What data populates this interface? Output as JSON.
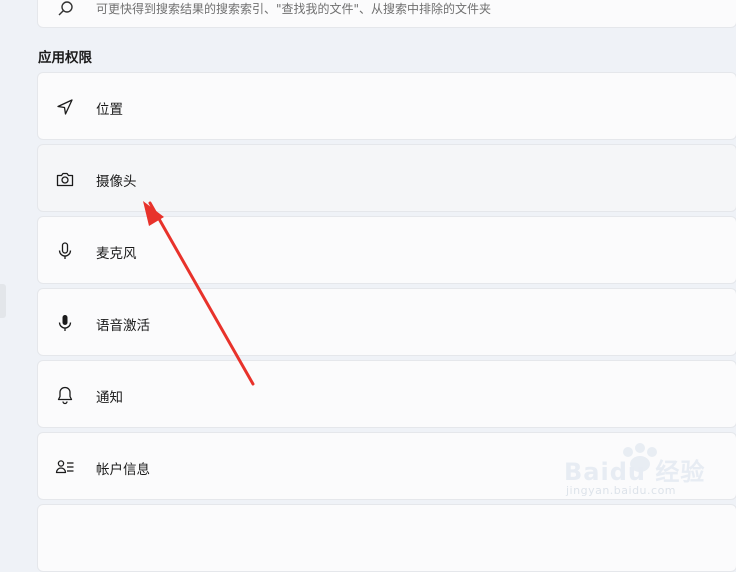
{
  "top_card": {
    "description": "可更快得到搜索结果的搜索索引、\"查找我的文件\"、从搜索中排除的文件夹"
  },
  "section_title": "应用权限",
  "items": [
    {
      "label": "位置",
      "icon": "location-icon"
    },
    {
      "label": "摄像头",
      "icon": "camera-icon"
    },
    {
      "label": "麦克风",
      "icon": "microphone-icon"
    },
    {
      "label": "语音激活",
      "icon": "voice-activation-icon"
    },
    {
      "label": "通知",
      "icon": "bell-icon"
    },
    {
      "label": "帐户信息",
      "icon": "account-info-icon"
    }
  ],
  "watermark": {
    "brand": "Baidu 经验",
    "url": "jingyan.baidu.com"
  },
  "colors": {
    "arrow": "#e8322b",
    "background": "#eff2f7",
    "card": "#fbfbfc"
  }
}
